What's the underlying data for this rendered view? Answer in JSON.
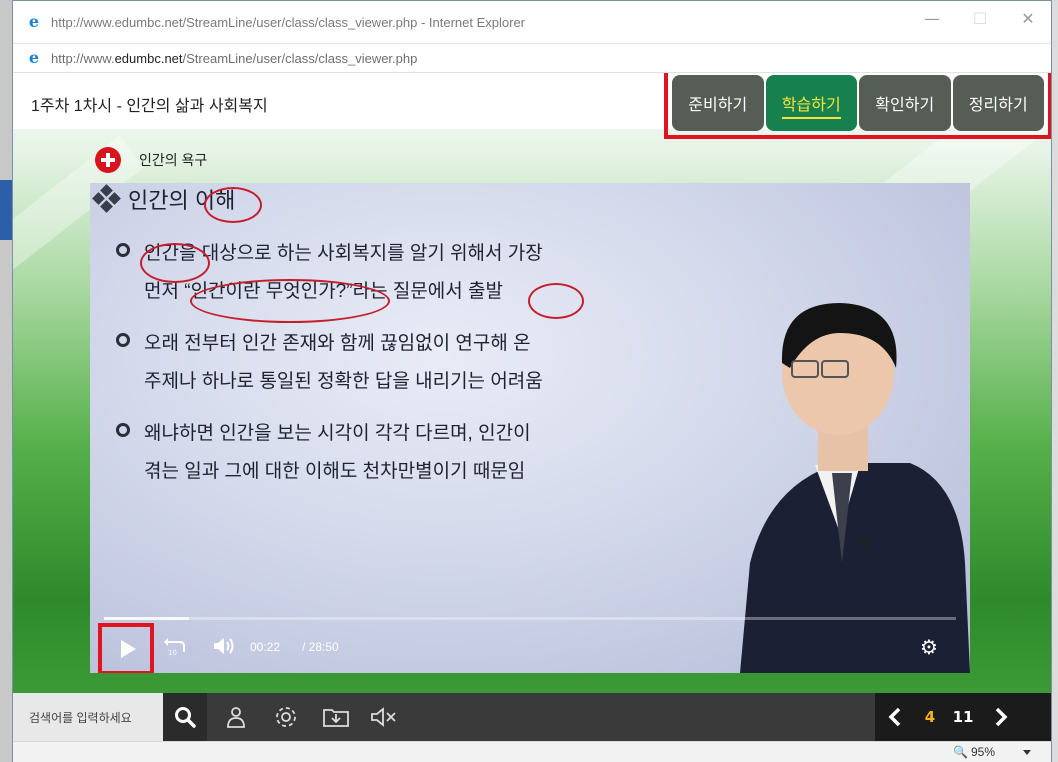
{
  "window": {
    "title": "http://www.edumbc.net/StreamLine/user/class/class_viewer.php - Internet Explorer",
    "controls": {
      "minimize": "—",
      "maximize": "☐",
      "close": "✕"
    }
  },
  "address_bar": {
    "url_prefix": "http://www.",
    "url_domain": "edumbc.net",
    "url_path": "/StreamLine/user/class/class_viewer.php"
  },
  "lesson": {
    "title": "1주차 1차시 - 인간의 삶과 사회복지"
  },
  "tabs": [
    {
      "label": "준비하기",
      "active": false
    },
    {
      "label": "학습하기",
      "active": true
    },
    {
      "label": "확인하기",
      "active": false
    },
    {
      "label": "정리하기",
      "active": false
    }
  ],
  "section": {
    "label": "인간의 욕구"
  },
  "slide": {
    "title": "인간의 이해",
    "bullets": [
      {
        "line1": "인간을 대상으로 하는 사회복지를 알기 위해서 가장",
        "line2": "먼저 “인간이란 무엇인가?”라는 질문에서 출발"
      },
      {
        "line1": "오래 전부터 인간 존재와 함께 끊임없이 연구해 온",
        "line2": "주제나 하나로 통일된 정확한 답을 내리기는 어려움"
      },
      {
        "line1": "왜냐하면 인간을 보는 시각이 각각 다르며, 인간이",
        "line2": "겪는 일과 그에 대한 이해도 천차만별이기 때문임"
      }
    ]
  },
  "player": {
    "current_time": "00:22",
    "total_time": "/ 28:50",
    "progress_fraction": 0.013,
    "rewind_label": "10"
  },
  "toolbar": {
    "search_placeholder": "검색어를 입력하세요",
    "current_page": "4",
    "total_pages": "11"
  },
  "status": {
    "zoom": "95%"
  },
  "colors": {
    "accent_red": "#e0141e",
    "active_tab_bg": "#16804f",
    "active_tab_text": "#f4e43a",
    "tab_bg": "#555d55",
    "annotation_red": "#c41e2a"
  }
}
